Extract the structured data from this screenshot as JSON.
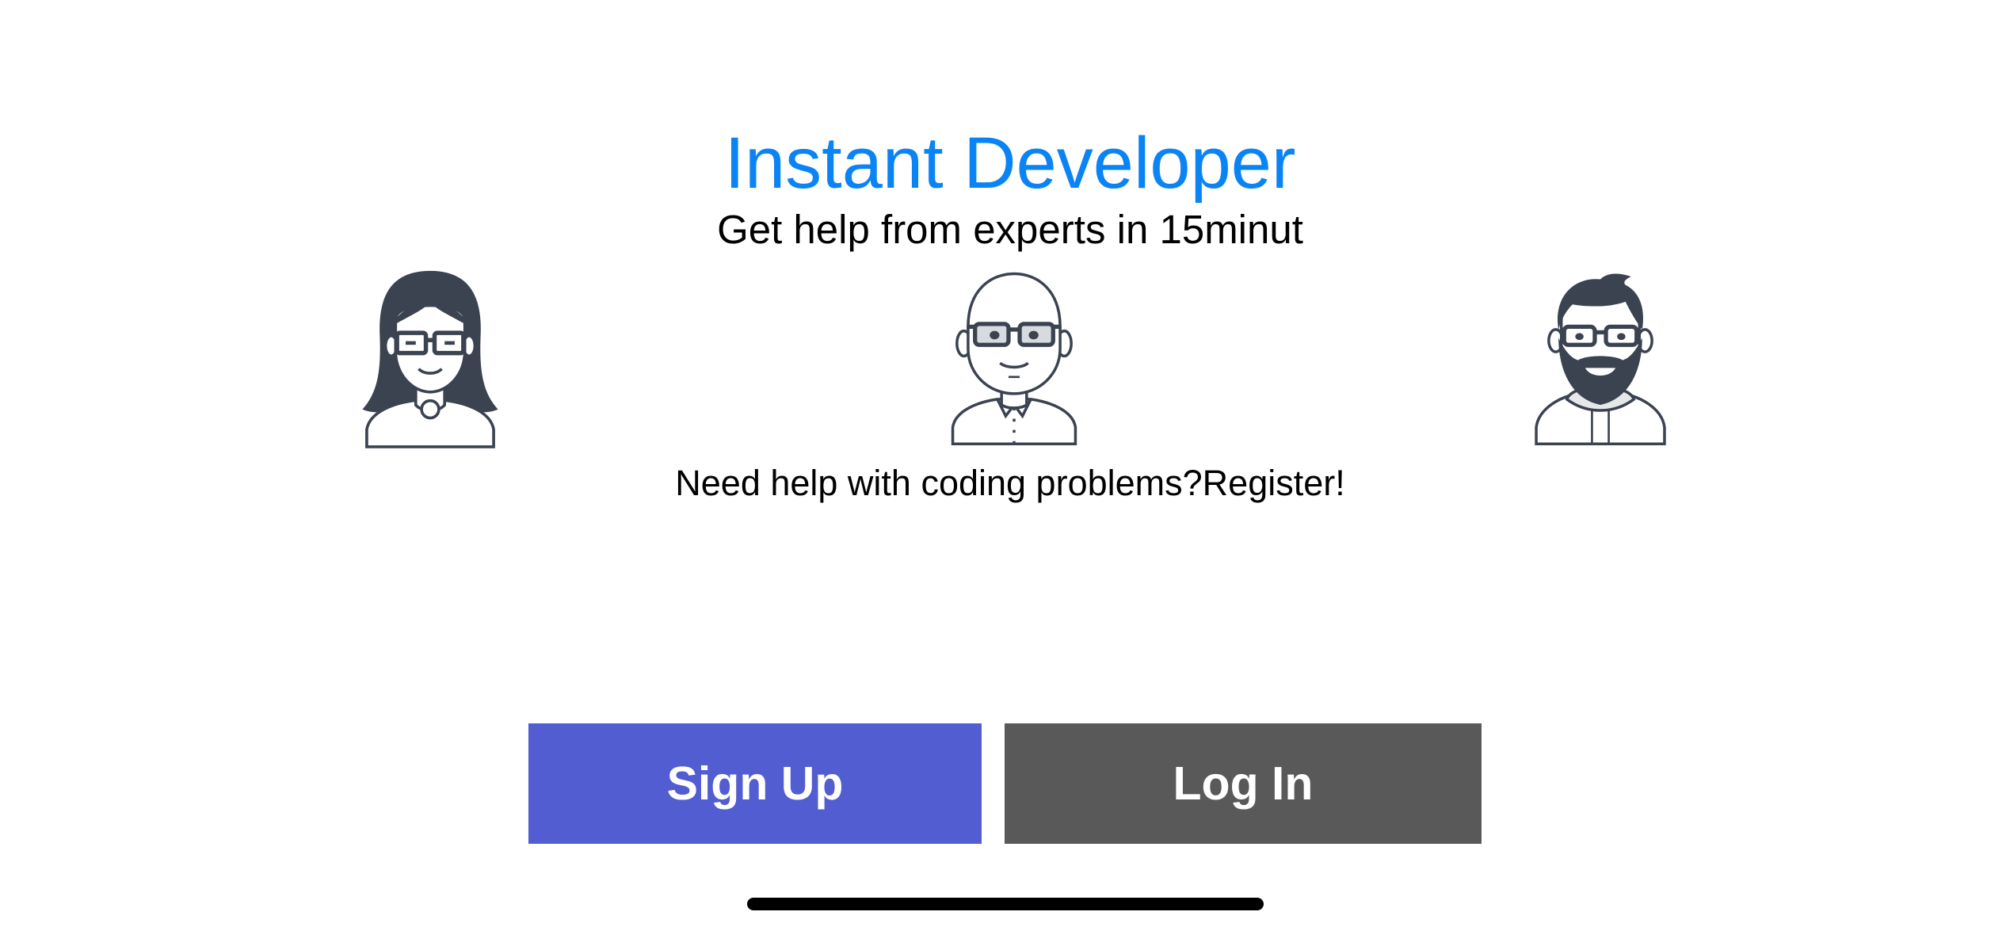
{
  "header": {
    "title": "Instant Developer",
    "subtitle": "Get help from experts in 15minut"
  },
  "avatars": [
    {
      "icon": "woman-with-glasses-avatar-icon"
    },
    {
      "icon": "bald-man-with-glasses-avatar-icon"
    },
    {
      "icon": "bearded-man-with-glasses-avatar-icon"
    }
  ],
  "main": {
    "prompt": "Need help with coding problems?Register!"
  },
  "actions": {
    "signup_label": "Sign Up",
    "login_label": "Log In"
  },
  "colors": {
    "title": "#0a84f5",
    "signup_bg": "#525dd1",
    "login_bg": "#595959",
    "icon_stroke": "#3b4250"
  }
}
